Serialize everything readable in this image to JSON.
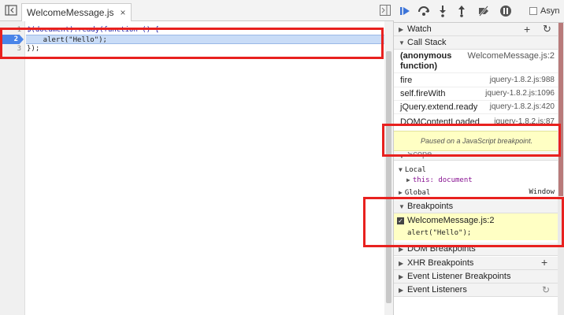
{
  "editor": {
    "tab": {
      "filename": "WelcomeMessage.js",
      "close": "×"
    },
    "lines": [
      {
        "number": "1",
        "text": "$(document).ready(function () {"
      },
      {
        "number": "2",
        "text": "    alert(\"Hello\");"
      },
      {
        "number": "3",
        "text": "});"
      }
    ],
    "breakpoint_line": "2"
  },
  "toolbar": {
    "icons": [
      "resume-icon",
      "step-over-icon",
      "step-into-icon",
      "step-out-icon",
      "deactivate-breakpoints-icon",
      "pause-on-exceptions-icon"
    ],
    "async_label": "Asyn"
  },
  "sidebar": {
    "watch": {
      "title": "Watch",
      "add": "+",
      "refresh": "↻"
    },
    "call_stack": {
      "title": "Call Stack",
      "frames": [
        {
          "fn": "(anonymous function)",
          "loc": "WelcomeMessage.js:2",
          "selected": true
        },
        {
          "fn": "fire",
          "loc": "jquery-1.8.2.js:988"
        },
        {
          "fn": "self.fireWith",
          "loc": "jquery-1.8.2.js:1096"
        },
        {
          "fn": "jQuery.extend.ready",
          "loc": "jquery-1.8.2.js:420"
        },
        {
          "fn": "DOMContentLoaded",
          "loc": "jquery-1.8.2.js:87"
        }
      ]
    },
    "paused_message": "Paused on a JavaScript breakpoint.",
    "scope": {
      "title": "Scope",
      "local_label": "Local",
      "this_entry": "this: document",
      "global_label": "Global",
      "global_value": "Window"
    },
    "breakpoints": {
      "title": "Breakpoints",
      "entry_file": "WelcomeMessage.js:2",
      "entry_code": "alert(\"Hello\");",
      "checked": true
    },
    "collapsed_sections": [
      {
        "title": "DOM Breakpoints"
      },
      {
        "title": "XHR Breakpoints",
        "action": "+"
      },
      {
        "title": "Event Listener Breakpoints"
      },
      {
        "title": "Event Listeners",
        "action": "↻"
      }
    ]
  },
  "colors": {
    "highlight_frame": "#e8211f",
    "breakpoint_marker": "#4a84e8",
    "paused_bg": "#ffffc4",
    "current_line_bg": "#c9dcf7"
  }
}
